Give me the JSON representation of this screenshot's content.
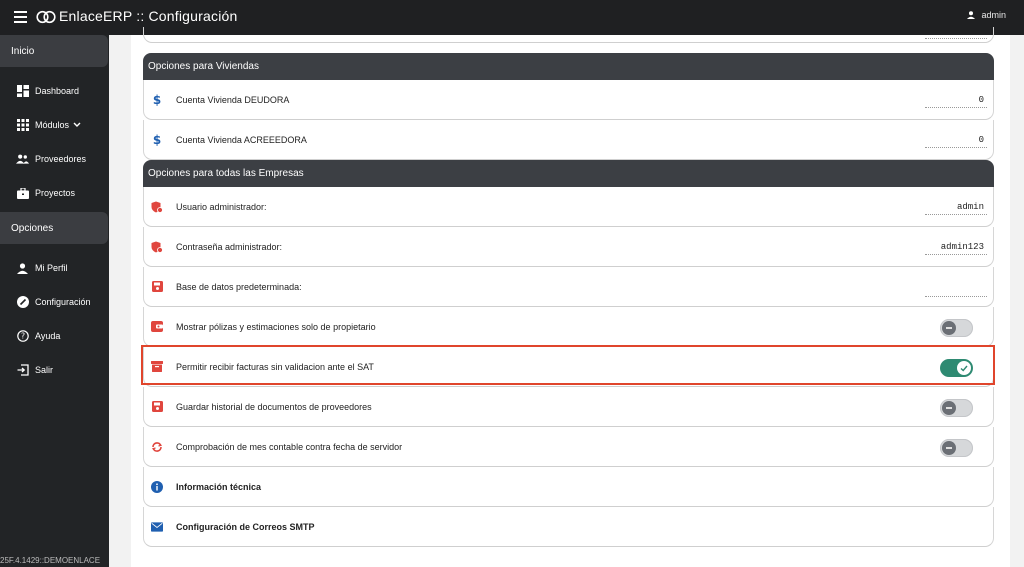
{
  "app": {
    "title": "EnlaceERP :: Configuración",
    "user": "admin"
  },
  "sidebar": {
    "sections": [
      "Inicio",
      "Opciones"
    ],
    "inicio_items": [
      {
        "label": "Dashboard",
        "icon": "dashboard-icon"
      },
      {
        "label": "Módulos",
        "icon": "grid-icon"
      },
      {
        "label": "Proveedores",
        "icon": "people-icon"
      },
      {
        "label": "Proyectos",
        "icon": "briefcase-icon"
      }
    ],
    "opciones_items": [
      {
        "label": "Mi Perfil",
        "icon": "person-icon"
      },
      {
        "label": "Configuración",
        "icon": "wrench-icon"
      },
      {
        "label": "Ayuda",
        "icon": "help-icon"
      },
      {
        "label": "Salir",
        "icon": "logout-icon"
      }
    ],
    "version": "25F.4.1429::DEMOENLACE"
  },
  "viviendas": {
    "title": "Opciones para Viviendas",
    "rows": [
      {
        "label": "Cuenta Vivienda DEUDORA",
        "value": "0"
      },
      {
        "label": "Cuenta Vivienda ACREEEDORA",
        "value": "0"
      }
    ]
  },
  "empresas": {
    "title": "Opciones para todas las Empresas",
    "admin_user_label": "Usuario administrador:",
    "admin_user_value": "admin",
    "admin_pass_label": "Contraseña administrador:",
    "admin_pass_value": "admin123",
    "default_db_label": "Base de datos predeterminada:",
    "default_db_value": "",
    "toggles": [
      {
        "label": "Mostrar pólizas y estimaciones solo de propietario",
        "on": false
      },
      {
        "label": "Permitir recibir facturas sin validacion ante el SAT",
        "on": true
      },
      {
        "label": "Guardar historial de documentos de proveedores",
        "on": false
      },
      {
        "label": "Comprobación de mes contable contra fecha de servidor",
        "on": false
      }
    ],
    "info_label": "Información técnica",
    "smtp_label": "Configuración de Correos SMTP"
  },
  "colors": {
    "accent_green": "#2e8a72",
    "icon_red": "#e0463e",
    "icon_blue": "#1f5fb0",
    "highlight": "#e0452c"
  }
}
